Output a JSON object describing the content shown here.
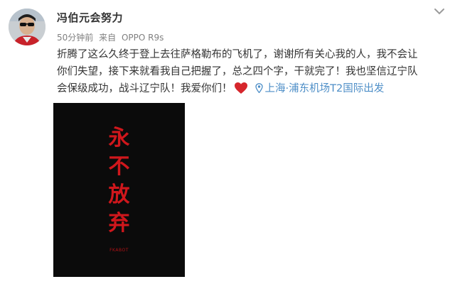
{
  "post": {
    "username": "冯伯元会努力",
    "time": "50分钟前",
    "source_prefix": "来自",
    "source_device": "OPPO R9s",
    "text_lines": [
      "折腾了这么久终于登上去往萨格勒布的飞机了，谢谢所有关心我的人，我不会让",
      "你们失望，接下来就看我自己把握了，总之四个字，干就完了！我也坚信辽宁队",
      "会保级成功，战斗辽宁队！我爱你们！"
    ],
    "heart_icon": "red-heart-emoji",
    "location": "上海·浦东机场T2国际出发",
    "location_icon": "location-pin-icon",
    "more_icon": "chevron-down-icon",
    "colors": {
      "link": "#4d8ec7",
      "poster_bg": "#0b0b0b",
      "poster_text": "#d0171c",
      "heart": "#d6262c"
    }
  },
  "poster": {
    "title_chars": [
      "永",
      "不",
      "放",
      "弃"
    ],
    "brand": "FKABOT"
  }
}
